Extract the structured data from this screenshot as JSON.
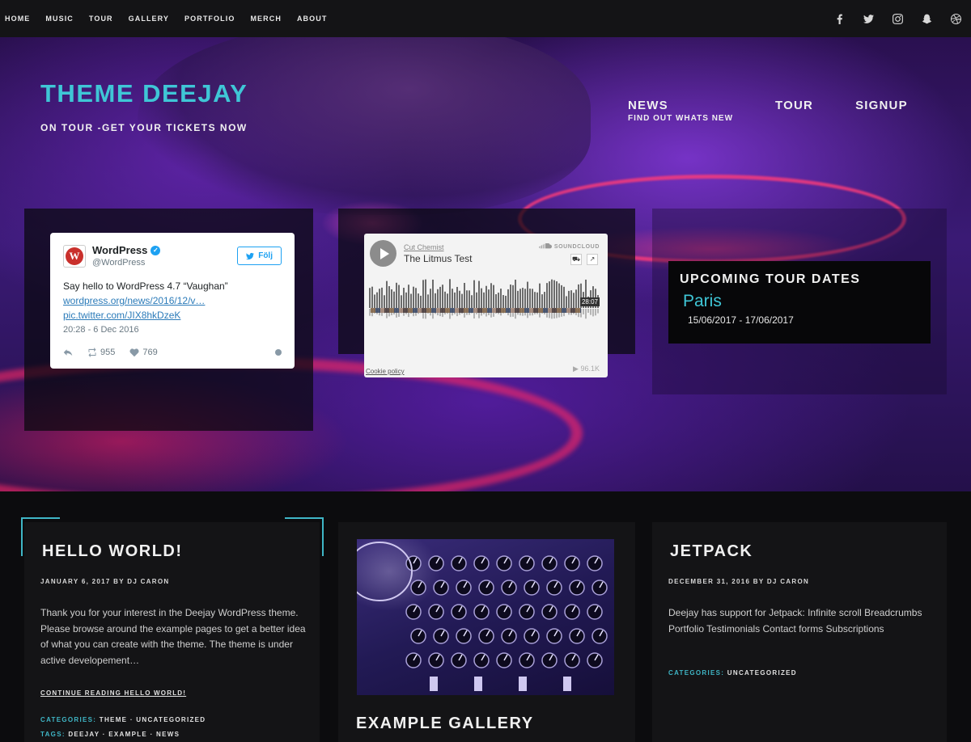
{
  "topnav": {
    "items": [
      "HOME",
      "MUSIC",
      "TOUR",
      "GALLERY",
      "PORTFOLIO",
      "MERCH",
      "ABOUT"
    ],
    "social_icons": [
      "facebook-icon",
      "twitter-icon",
      "instagram-icon",
      "snapchat-icon",
      "dribbble-icon"
    ]
  },
  "hero": {
    "title": "THEME DEEJAY",
    "tagline": "ON TOUR -GET YOUR TICKETS NOW",
    "nav": [
      {
        "label": "NEWS",
        "sub": "FIND OUT WHATS NEW"
      },
      {
        "label": "TOUR",
        "sub": ""
      },
      {
        "label": "SIGNUP",
        "sub": ""
      }
    ]
  },
  "tweet": {
    "name": "WordPress",
    "handle": "@WordPress",
    "follow": "Följ",
    "text": "Say hello to WordPress 4.7 “Vaughan”",
    "link1": "wordpress.org/news/2016/12/v…",
    "link2": "pic.twitter.com/JIX8hkDzeK",
    "date": "20:28 - 6 Dec 2016",
    "retweets": "955",
    "likes": "769"
  },
  "soundcloud": {
    "artist": "Cut Chemist",
    "track": "The Litmus Test",
    "brand": "SOUNDCLOUD",
    "duration": "28:07",
    "cookie": "Cookie policy",
    "plays": "▶ 96.1K"
  },
  "tour": {
    "title": "UPCOMING TOUR DATES",
    "city": "Paris",
    "dates": "15/06/2017 - 17/06/2017"
  },
  "posts": [
    {
      "title": "HELLO WORLD!",
      "meta": "JANUARY 6, 2017 BY DJ CARON",
      "body": "Thank you for your interest in the Deejay WordPress theme. Please browse around the example pages to get a better idea of what you can create with the theme. The theme is under active developement…",
      "more": "CONTINUE READING HELLO WORLD!",
      "cat_key": "CATEGORIES:",
      "cat_val": "THEME · UNCATEGORIZED",
      "tag_key": "TAGS:",
      "tag_val": "DEEJAY · EXAMPLE · NEWS"
    },
    {
      "title": "EXAMPLE GALLERY"
    },
    {
      "title": "JETPACK",
      "meta": "DECEMBER 31, 2016 BY DJ CARON",
      "body": "Deejay has support for Jetpack: Infinite scroll Breadcrumbs Portfolio Testimonials Contact forms Subscriptions",
      "cat_key": "CATEGORIES:",
      "cat_val": "UNCATEGORIZED"
    }
  ],
  "colors": {
    "accent": "#3fc6d6",
    "background": "#0c0c0e",
    "card": "#141416"
  }
}
